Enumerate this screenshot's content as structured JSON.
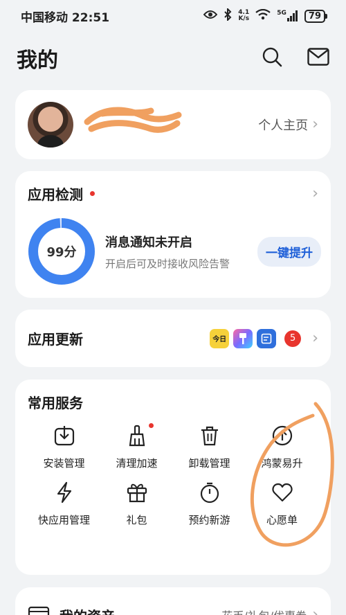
{
  "status_bar": {
    "carrier_time": "中国移动 22:51",
    "net_speed_top": "4.1",
    "net_speed_bottom": "K/s",
    "network": "5G",
    "battery": "79",
    "icons": [
      "eye-icon",
      "bluetooth-icon",
      "wifi-icon",
      "signal-icon",
      "battery-icon"
    ]
  },
  "header": {
    "title": "我的",
    "icons": [
      "search-icon",
      "mail-icon"
    ]
  },
  "profile": {
    "link_label": "个人主页"
  },
  "app_detection": {
    "title": "应用检测",
    "score": "99分",
    "score_fraction": 0.99,
    "message_title": "消息通知未开启",
    "message_sub": "开启后可及时接收风险告警",
    "button_label": "一键提升"
  },
  "app_update": {
    "title": "应用更新",
    "app_icon_text": "今日",
    "count": "5"
  },
  "services": {
    "title": "常用服务",
    "items": [
      {
        "label": "安装管理",
        "icon": "install-icon"
      },
      {
        "label": "清理加速",
        "icon": "broom-icon"
      },
      {
        "label": "卸载管理",
        "icon": "trash-icon"
      },
      {
        "label": "鸿蒙易升",
        "icon": "upgrade-icon"
      },
      {
        "label": "快应用管理",
        "icon": "lightning-icon"
      },
      {
        "label": "礼包",
        "icon": "gift-icon"
      },
      {
        "label": "预约新游",
        "icon": "stopwatch-icon"
      },
      {
        "label": "心愿单",
        "icon": "heart-icon"
      }
    ]
  },
  "assets": {
    "title": "我的资产",
    "right_text": "花币/礼包/优惠券"
  },
  "colors": {
    "accent": "#1e5fd8",
    "ring": "#3f83f0",
    "alert": "#e8352e",
    "annotation": "#f0a060"
  }
}
